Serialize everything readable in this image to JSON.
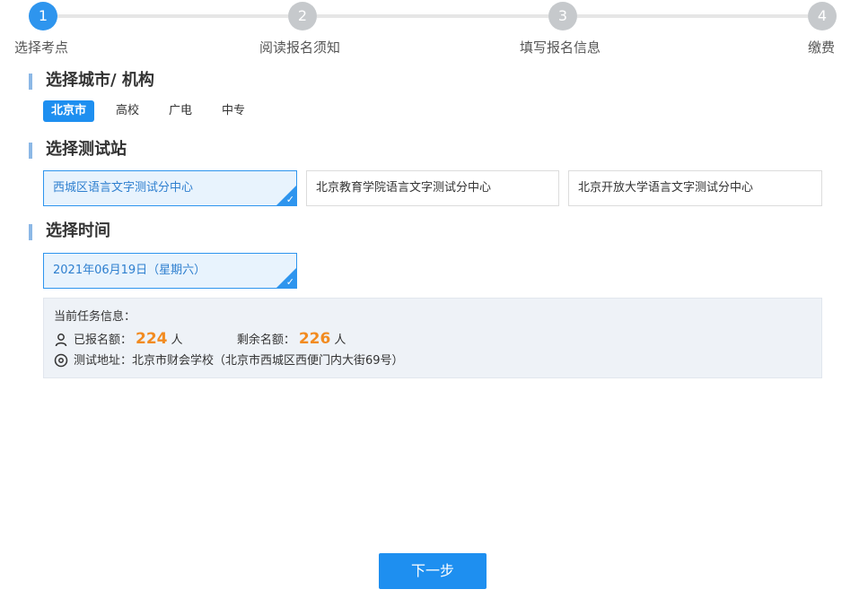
{
  "stepper": {
    "steps": [
      {
        "number": "1",
        "label": "选择考点"
      },
      {
        "number": "2",
        "label": "阅读报名须知"
      },
      {
        "number": "3",
        "label": "填写报名信息"
      },
      {
        "number": "4",
        "label": "缴费"
      }
    ],
    "active_step": 1
  },
  "section_city": {
    "title": "选择城市/ 机构",
    "tabs": [
      {
        "label": "北京市",
        "selected": true
      },
      {
        "label": "高校",
        "selected": false
      },
      {
        "label": "广电",
        "selected": false
      },
      {
        "label": "中专",
        "selected": false
      }
    ]
  },
  "section_station": {
    "title": "选择测试站",
    "options": [
      {
        "label": "西城区语言文字测试分中心",
        "selected": true
      },
      {
        "label": "北京教育学院语言文字测试分中心",
        "selected": false
      },
      {
        "label": "北京开放大学语言文字测试分中心",
        "selected": false
      }
    ]
  },
  "section_time": {
    "title": "选择时间",
    "options": [
      {
        "label": "2021年06月19日（星期六）",
        "selected": true
      }
    ]
  },
  "info": {
    "heading": "当前任务信息：",
    "registered_label": "已报名额：",
    "registered_count": "224",
    "registered_unit": "人",
    "remaining_label": "剩余名额：",
    "remaining_count": "226",
    "remaining_unit": "人",
    "address_label": "测试地址：",
    "address_value": "北京市财会学校（北京市西城区西便门内大街69号）",
    "icons": {
      "person": "user-icon",
      "location": "location-pin-icon"
    }
  },
  "actions": {
    "next_label": "下一步"
  },
  "colors": {
    "accent": "#1e8ff0",
    "step_inactive": "#c6c9cc",
    "highlight_number": "#f28b20",
    "section_bar": "#8cb8e6"
  },
  "check_symbol": "✓"
}
